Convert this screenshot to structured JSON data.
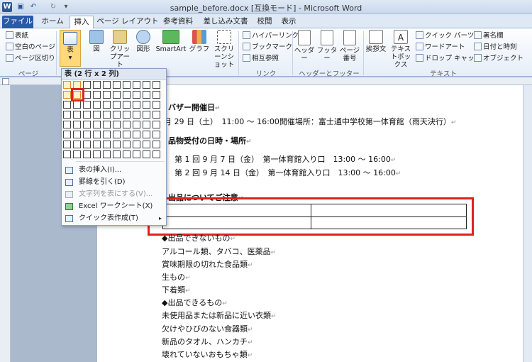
{
  "window": {
    "title": "sample_before.docx [互換モード] - Microsoft Word"
  },
  "tabs": [
    "ファイル",
    "ホーム",
    "挿入",
    "ページ レイアウト",
    "参考資料",
    "差し込み文書",
    "校閲",
    "表示"
  ],
  "ribbon": {
    "pages_group": {
      "items": [
        "表紙",
        "空白のページ",
        "ページ区切り"
      ],
      "label": "ページ"
    },
    "table_button": "表",
    "illustration_buttons": [
      "図",
      "クリップアート",
      "図形",
      "SmartArt",
      "グラフ",
      "スクリーンショット"
    ],
    "links_group": {
      "items": [
        "ハイパーリンク",
        "ブックマーク",
        "相互参照"
      ],
      "label": "リンク"
    },
    "header_footer_group": {
      "items": [
        "ヘッダー",
        "フッター",
        "ページ番号"
      ],
      "label": "ヘッダーとフッター"
    },
    "text_group": {
      "big": [
        "挨拶文",
        "テキストボックス"
      ],
      "items": [
        "クイック パーツ",
        "ワードアート",
        "ドロップ キャップ",
        "署名欄",
        "日付と時刻",
        "オブジェクト"
      ],
      "label": "テキスト"
    }
  },
  "table_dropdown": {
    "header": "表 (2 行 x 2 列)",
    "grid": {
      "cols": 10,
      "rows": 8,
      "selected_cols": 2,
      "selected_rows": 2
    },
    "menu_items": [
      {
        "label": "表の挿入(I)...",
        "enabled": true
      },
      {
        "label": "罫線を引く(D)",
        "enabled": true
      },
      {
        "label": "文字列を表にする(V)...",
        "enabled": false
      },
      {
        "label": "Excel ワークシート(X)",
        "enabled": true
      },
      {
        "label": "クイック表作成(T)",
        "enabled": true,
        "submenu": true
      }
    ]
  },
  "document": {
    "heading1": "バザー開催日",
    "date_line": "月 29 日（土）　11:00 ～ 16:00開催場所：富士通中学校第一体育館（雨天決行）",
    "heading2": "品物受付の日時・場所",
    "receipt1": "第 1 回 9 月 7 日（金）　第一体育館入り口　13:00 ～ 16:00",
    "receipt2": "第 2 回 9 月 14 日（金）　第一体育館入り口　13:00 ～ 16:00",
    "heading3": "出品についてご注意",
    "list_lines": [
      "◆出品できないもの",
      "アルコール類、タバコ、医薬品",
      "賞味期限の切れた食品類",
      "生もの",
      "下着類",
      "◆出品できるもの",
      "未使用品または新品に近い衣類",
      "欠けやひびのない食器類",
      "新品のタオル、ハンカチ",
      "壊れていないおもちゃ類"
    ]
  }
}
